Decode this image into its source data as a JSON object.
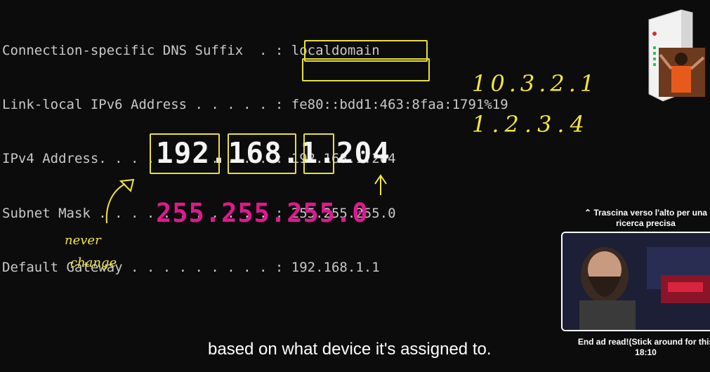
{
  "terminal": {
    "lines": [
      "Connection-specific DNS Suffix  . : localdomain",
      "Link-local IPv6 Address . . . . . : fe80::bdd1:463:8faa:1791%19",
      "IPv4 Address. . . . . . . . . . . : 192.168.1.204",
      "Subnet Mask . . . . . . . . . . . : 255.255.255.0",
      "Default Gateway . . . . . . . . . : 192.168.1.1"
    ]
  },
  "diagram": {
    "ip_octets": [
      "192",
      "168",
      "1",
      "204"
    ],
    "ip_dot": ".",
    "subnet_mask": "255.255.255.0"
  },
  "annotations": {
    "ip_example_1": "10.3.2.1",
    "ip_example_2": "1.2.3.4",
    "never": "never",
    "change": "change"
  },
  "caption": "based on what device it's assigned to.",
  "overlay": {
    "scrub_hint": "⌃ Trascina verso l'alto per una ricerca precisa",
    "end_label": "End ad read!(Stick around for this",
    "end_time": "18:10"
  },
  "colors": {
    "highlight": "#e8e03a",
    "mask": "#e0198f",
    "background": "#0c0c0c"
  }
}
